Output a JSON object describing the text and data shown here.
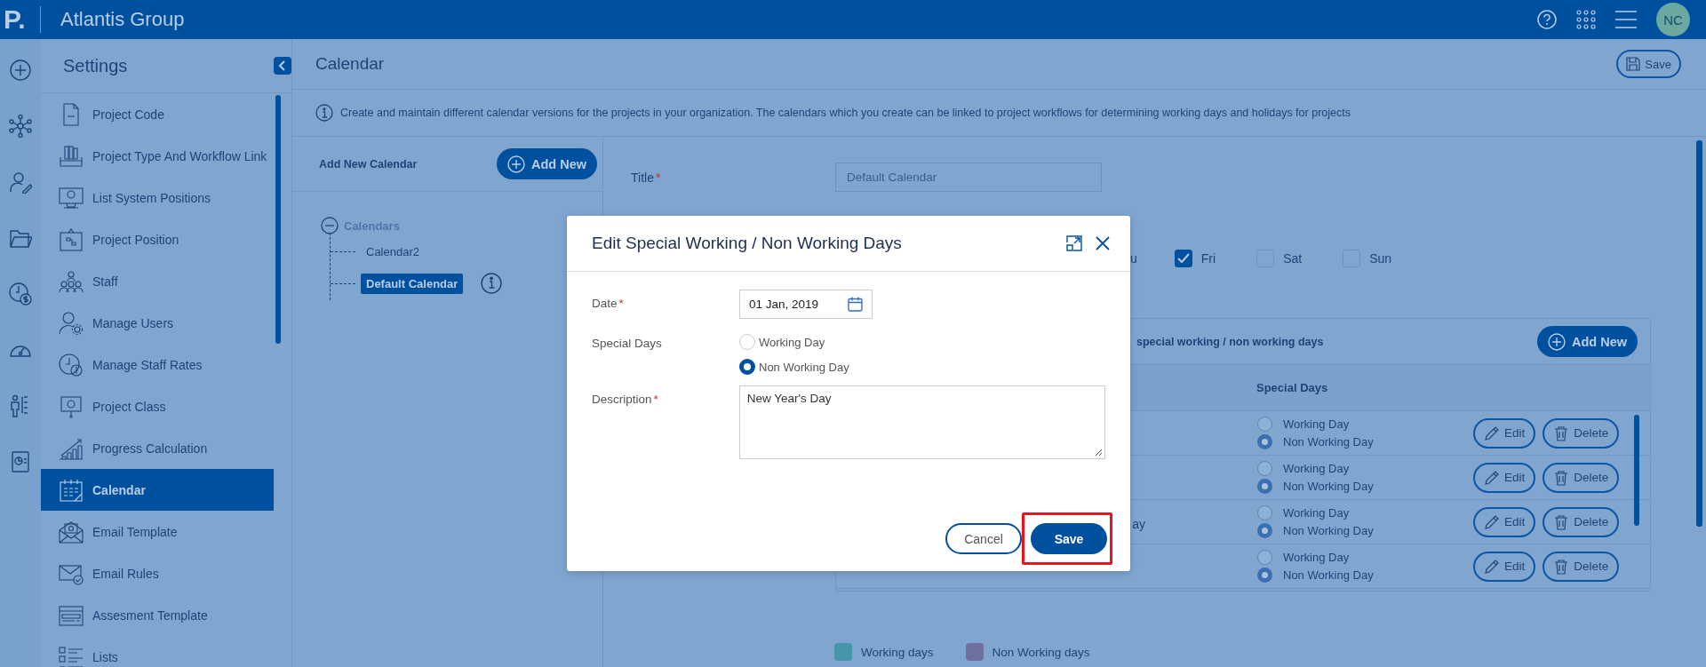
{
  "app": {
    "logo": "P.",
    "title": "Atlantis Group",
    "avatar": "NC"
  },
  "settings": {
    "title": "Settings",
    "items": [
      {
        "label": "Project Code",
        "selected": false
      },
      {
        "label": "Project Type And Workflow Link",
        "selected": false
      },
      {
        "label": "List System Positions",
        "selected": false
      },
      {
        "label": "Project Position",
        "selected": false
      },
      {
        "label": "Staff",
        "selected": false
      },
      {
        "label": "Manage Users",
        "selected": false
      },
      {
        "label": "Manage Staff Rates",
        "selected": false
      },
      {
        "label": "Project Class",
        "selected": false
      },
      {
        "label": "Progress Calculation",
        "selected": false
      },
      {
        "label": "Calendar",
        "selected": true
      },
      {
        "label": "Email Template",
        "selected": false
      },
      {
        "label": "Email Rules",
        "selected": false
      },
      {
        "label": "Assesment Template",
        "selected": false
      },
      {
        "label": "Lists",
        "selected": false
      }
    ]
  },
  "page": {
    "title": "Calendar",
    "save": "Save",
    "info": "Create and maintain different calendar versions for the projects in your organization. The calendars which you create can be linked to project workflows for determining working days and holidays for projects"
  },
  "calendars": {
    "heading": "Add New Calendar",
    "add": "Add New",
    "tree": {
      "label": "Calendars",
      "expanded": true,
      "children": [
        {
          "label": "Calendar2",
          "selected": false
        },
        {
          "label": "Default Calendar",
          "selected": true
        }
      ]
    }
  },
  "form": {
    "title_label": "Title",
    "mark": "*",
    "title_value": "Default Calendar",
    "weekdays": [
      {
        "label": "u"
      },
      {
        "label": "Fri",
        "checked": true
      },
      {
        "label": "Sat",
        "checked": false
      },
      {
        "label": "Sun",
        "checked": false
      }
    ]
  },
  "special": {
    "heading": "special working / non working days",
    "add": "Add New",
    "column": "Special Days",
    "rows": [
      {
        "options": [
          {
            "label": "Working Day",
            "selected": false
          },
          {
            "label": "Non Working Day",
            "selected": true
          }
        ],
        "edit": "Edit",
        "delete": "Delete"
      },
      {
        "options": [
          {
            "label": "Working Day",
            "selected": false
          },
          {
            "label": "Non Working Day",
            "selected": true
          }
        ],
        "edit": "Edit",
        "delete": "Delete"
      },
      {
        "fragment": "ay",
        "options": [
          {
            "label": "Working Day",
            "selected": false
          },
          {
            "label": "Non Working Day",
            "selected": true
          }
        ],
        "edit": "Edit",
        "delete": "Delete"
      },
      {
        "options": [
          {
            "label": "Working Day",
            "selected": false
          },
          {
            "label": "Non Working Day",
            "selected": true
          }
        ],
        "edit": "Edit",
        "delete": "Delete"
      }
    ]
  },
  "legend": [
    {
      "label": "Working days",
      "color": "#4496a8"
    },
    {
      "label": "Non Working days",
      "color": "#70709e"
    }
  ],
  "modal": {
    "title": "Edit Special Working / Non Working Days",
    "date_label": "Date",
    "date_mark": "*",
    "date_value": "01 Jan, 2019",
    "days_label": "Special Days",
    "options": [
      {
        "label": "Working Day",
        "selected": false
      },
      {
        "label": "Non Working Day",
        "selected": true
      }
    ],
    "desc_label": "Description",
    "desc_mark": "*",
    "desc_value": "New Year's Day",
    "cancel": "Cancel",
    "save": "Save",
    "save_highlighted": true
  }
}
